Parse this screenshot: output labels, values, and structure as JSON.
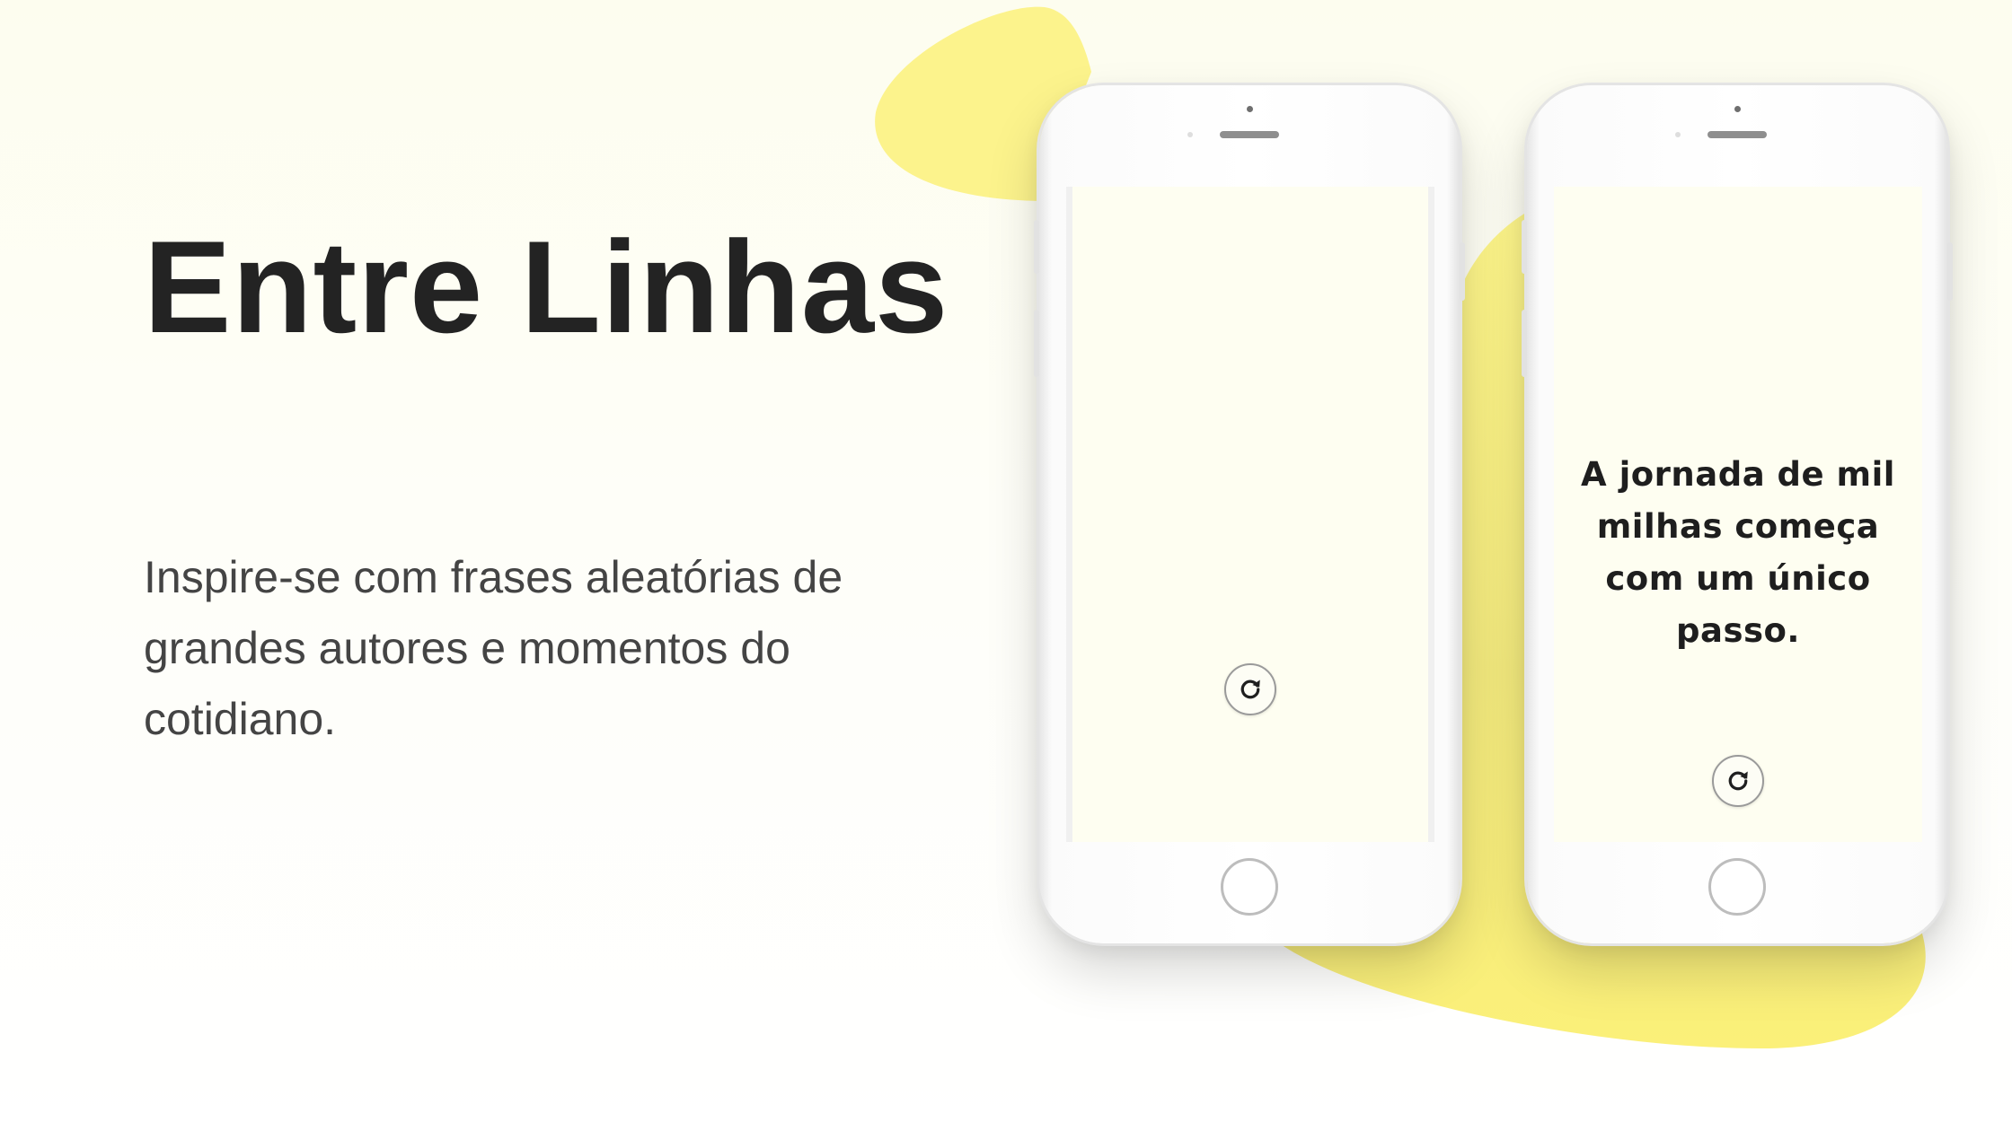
{
  "hero": {
    "title": "Entre Linhas",
    "subtitle": "Inspire-se com frases aleatórias de grandes autores e momentos do cotidiano."
  },
  "phones": [
    {
      "state": "loading",
      "quote": "",
      "reload_icon": "refresh-icon"
    },
    {
      "state": "quote-displayed",
      "quote": "A jornada de mil milhas começa com um único passo.",
      "reload_icon": "refresh-icon"
    }
  ],
  "colors": {
    "background": "#fdfdef",
    "accent_blob": "#fbf38b",
    "screen": "#fefef1",
    "title_text": "#232323",
    "subtitle_text": "#444444",
    "quote_text": "#1e1e1e"
  }
}
